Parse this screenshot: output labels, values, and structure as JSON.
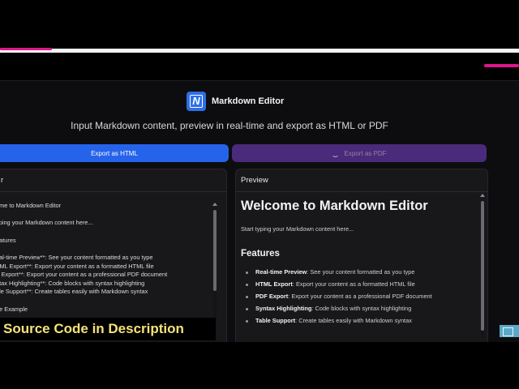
{
  "app": {
    "logo_text": "N",
    "title": "Markdown Editor",
    "subtitle": "Input Markdown content, preview in real-time and export as HTML or PDF"
  },
  "buttons": {
    "export_html": "Export as HTML",
    "export_pdf": "Export as PDF"
  },
  "editor": {
    "header": "r",
    "lines": [
      "ome to Markdown Editor",
      "yping your Markdown content here...",
      "eatures",
      "eal-time Preview**: See your content formatted as you type",
      "TML Export**: Export your content as a formatted HTML file",
      "F Export**: Export your content as a professional PDF document",
      "ntax Highlighting**: Code blocks with syntax highlighting",
      "ble Support**: Create tables easily with Markdown syntax",
      "de Example"
    ]
  },
  "preview": {
    "header": "Preview",
    "h1": "Welcome to Markdown Editor",
    "intro": "Start typing your Markdown content here...",
    "h2": "Features",
    "items": [
      {
        "bold": "Real-time Preview",
        "text": ": See your content formatted as you type"
      },
      {
        "bold": "HTML Export",
        "text": ": Export your content as a formatted HTML file"
      },
      {
        "bold": "PDF Export",
        "text": ": Export your content as a professional PDF document"
      },
      {
        "bold": "Syntax Highlighting",
        "text": ": Code blocks with syntax highlighting"
      },
      {
        "bold": "Table Support",
        "text": ": Create tables easily with Markdown syntax"
      }
    ]
  },
  "overlay": {
    "banner": "Source Code in  Description"
  },
  "colors": {
    "background": "#0d0d0f",
    "panel": "#18181b",
    "export_html_button": "#2563eb",
    "export_pdf_button": "#4a2a7a",
    "banner_text": "#f5e27a",
    "accent_stripe": "#e0158a"
  }
}
